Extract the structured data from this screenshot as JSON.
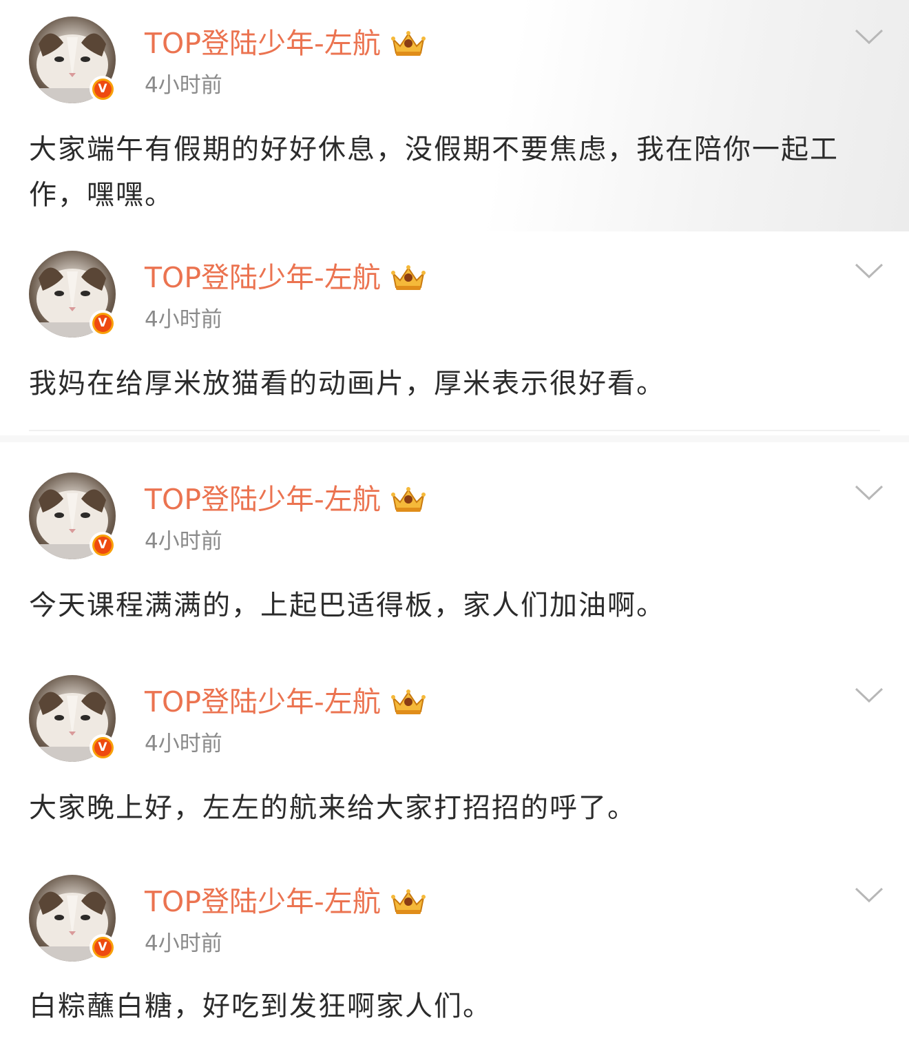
{
  "posts": [
    {
      "username": "TOP登陆少年-左航",
      "verified_badge": "V",
      "timestamp": "4小时前",
      "content": "大家端午有假期的好好休息，没假期不要焦虑，我在陪你一起工作，嘿嘿。"
    },
    {
      "username": "TOP登陆少年-左航",
      "verified_badge": "V",
      "timestamp": "4小时前",
      "content": "我妈在给厚米放猫看的动画片，厚米表示很好看。"
    },
    {
      "username": "TOP登陆少年-左航",
      "verified_badge": "V",
      "timestamp": "4小时前",
      "content": "今天课程满满的，上起巴适得板，家人们加油啊。"
    },
    {
      "username": "TOP登陆少年-左航",
      "verified_badge": "V",
      "timestamp": "4小时前",
      "content": "大家晚上好，左左的航来给大家打招招的呼了。"
    },
    {
      "username": "TOP登陆少年-左航",
      "verified_badge": "V",
      "timestamp": "4小时前",
      "content": "白粽蘸白糖，好吃到发狂啊家人们。"
    }
  ],
  "icons": {
    "avatar": "cat-avatar",
    "verified": "verified-v-badge-icon",
    "crown": "crown-vip-icon",
    "more": "chevron-down-icon"
  },
  "colors": {
    "username": "#eb7350",
    "timestamp": "#8a8a8a",
    "content": "#2b2b2b",
    "badge_outer": "#f8a10a",
    "badge_inner": "#ee4a10"
  }
}
